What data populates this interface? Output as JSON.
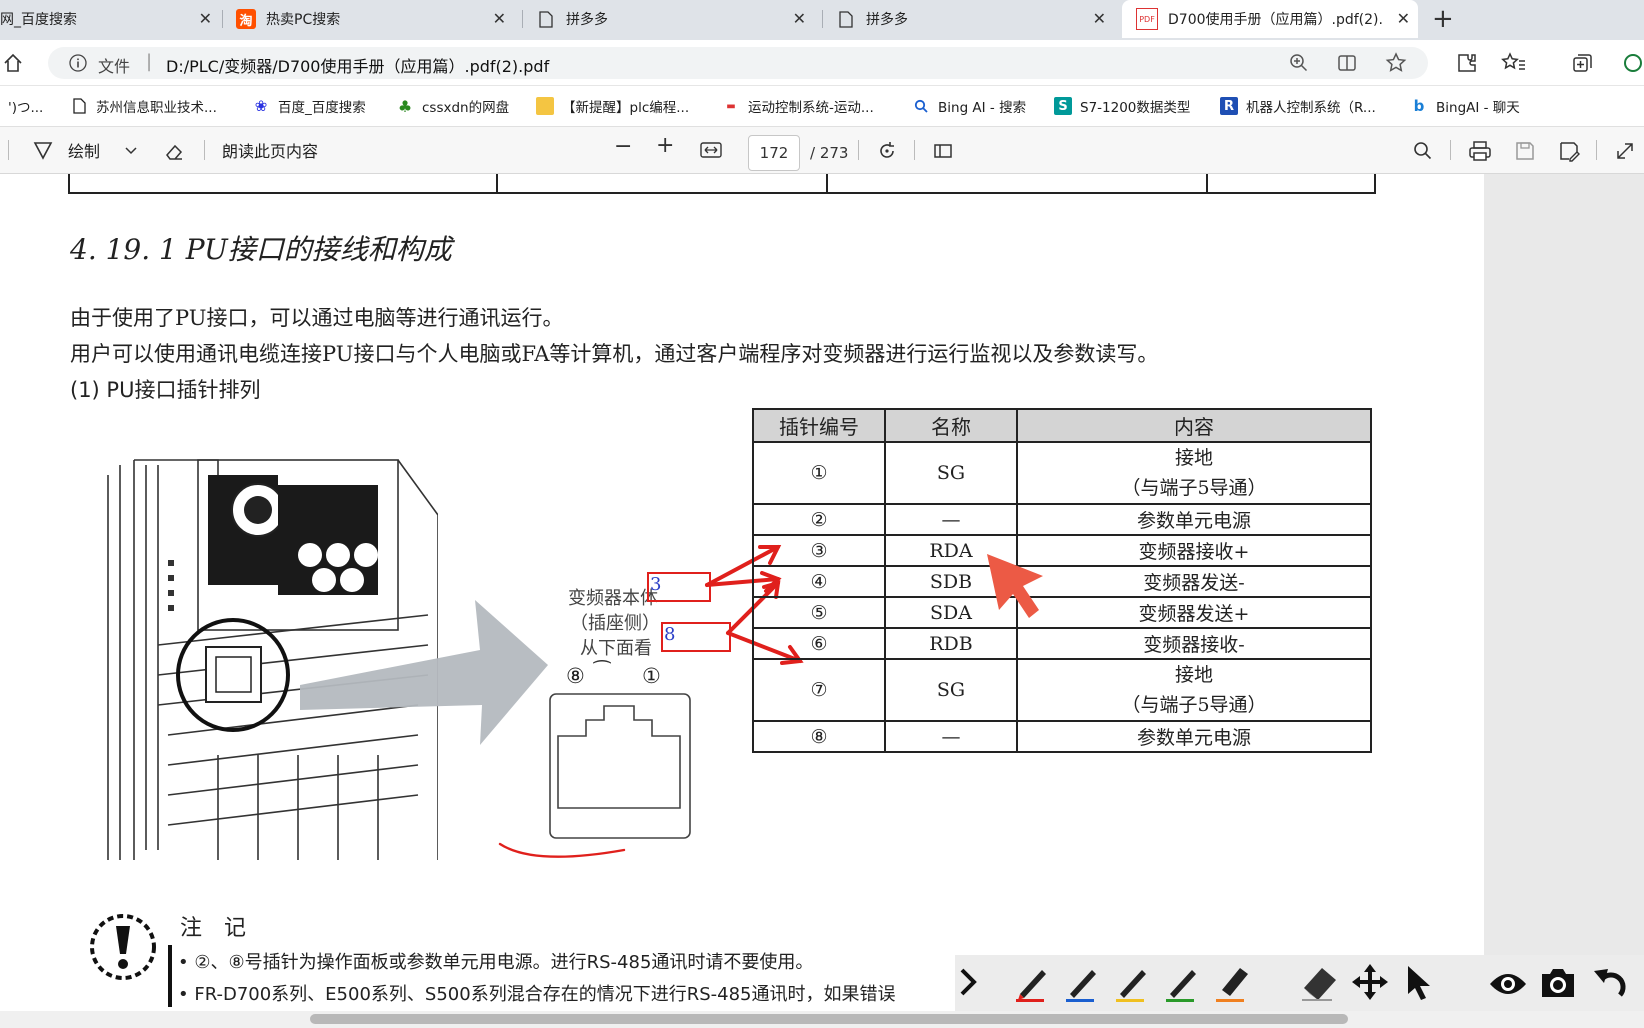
{
  "browser": {
    "tabs": [
      {
        "label": "网_百度搜索",
        "icon": "baidu-icon"
      },
      {
        "label": "热卖PC搜索",
        "icon": "taobao-icon"
      },
      {
        "label": "拼多多",
        "icon": "page-icon"
      },
      {
        "label": "拼多多",
        "icon": "page-icon"
      },
      {
        "label": "D700使用手册（应用篇）.pdf(2).",
        "icon": "pdf-icon",
        "active": true
      }
    ],
    "new_tab": "+",
    "address": {
      "info_label": "文件",
      "url": "D:/PLC/变频器/D700使用手册（应用篇）.pdf(2).pdf"
    },
    "bookmarks": [
      {
        "label": "')つ...",
        "icon": "bookmark-icon"
      },
      {
        "label": "苏州信息职业技术...",
        "icon": "page-icon"
      },
      {
        "label": "百度_百度搜索",
        "icon": "baidu-icon"
      },
      {
        "label": "cssxdn的网盘",
        "icon": "tree-icon"
      },
      {
        "label": "【新提醒】plc编程...",
        "icon": "folder-icon"
      },
      {
        "label": "运动控制系统-运动...",
        "icon": "site-icon"
      },
      {
        "label": "Bing AI - 搜索",
        "icon": "search-icon"
      },
      {
        "label": "S7-1200数据类型",
        "icon": "s-icon"
      },
      {
        "label": "机器人控制系统（R...",
        "icon": "r-icon"
      },
      {
        "label": "BingAI - 聊天",
        "icon": "bing-icon"
      }
    ]
  },
  "pdf_toolbar": {
    "draw_label": "绘制",
    "read_aloud_label": "朗读此页内容",
    "current_page": "172",
    "total_pages": "/ 273"
  },
  "document": {
    "section_title": "4. 19. 1  PU接口的接线和构成",
    "para1": "由于使用了PU接口，可以通过电脑等进行通讯运行。",
    "para2": "用户可以使用通讯电缆连接PU接口与个人电脑或FA等计算机，通过客户端程序对变频器进行运行监视以及参数读写。",
    "subheading": "(1)  PU接口插针排列",
    "figure": {
      "label_line1": "变频器本体",
      "label_line2": "（插座侧）",
      "label_line3": "从下面看",
      "pin_range_left": "⑧",
      "pin_range_right": "①",
      "annot_box1": "3",
      "annot_box2": "8"
    },
    "pin_table": {
      "headers": [
        "插针编号",
        "名称",
        "内容"
      ],
      "rows": [
        {
          "no": "①",
          "name": "SG",
          "content1": "接地",
          "content2": "（与端子5导通）"
        },
        {
          "no": "②",
          "name": "—",
          "content1": "参数单元电源",
          "content2": ""
        },
        {
          "no": "③",
          "name": "RDA",
          "content1": "变频器接收+",
          "content2": ""
        },
        {
          "no": "④",
          "name": "SDB",
          "content1": "变频器发送-",
          "content2": ""
        },
        {
          "no": "⑤",
          "name": "SDA",
          "content1": "变频器发送+",
          "content2": ""
        },
        {
          "no": "⑥",
          "name": "RDB",
          "content1": "变频器接收-",
          "content2": ""
        },
        {
          "no": "⑦",
          "name": "SG",
          "content1": "接地",
          "content2": "（与端子5导通）"
        },
        {
          "no": "⑧",
          "name": "—",
          "content1": "参数单元电源",
          "content2": ""
        }
      ]
    },
    "notes_title": "注　记",
    "note1": "• ②、⑧号插针为操作面板或参数单元用电源。进行RS-485通讯时请不要使用。",
    "note2": "• FR-D700系列、E500系列、S500系列混合存在的情况下进行RS-485通讯时，如果错误"
  },
  "annotation_tools": [
    "chevron-right-icon",
    "red-pen-icon",
    "blue-pen-icon",
    "yellow-pen-icon",
    "green-pen-icon",
    "orange-highlighter-icon",
    "eraser-icon",
    "move-icon",
    "pointer-icon",
    "eye-icon",
    "camera-icon",
    "undo-icon"
  ],
  "colors": {
    "annotation_red": "#e0201c",
    "cursor_red": "#ec5a45",
    "gray_arrow": "#b4b9bf"
  }
}
